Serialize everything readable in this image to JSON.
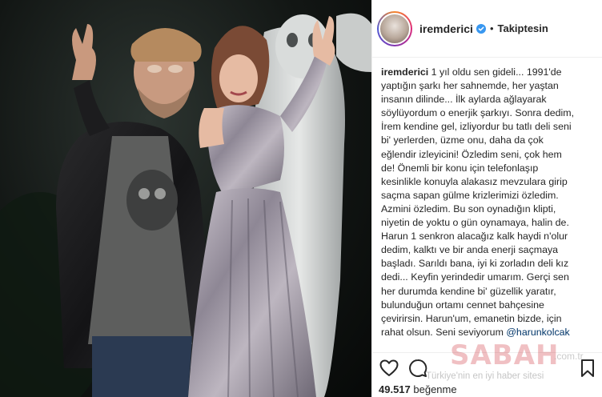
{
  "post": {
    "username": "iremderici",
    "separator": "•",
    "follow_status": "Takiptesin",
    "caption_user": "iremderici",
    "caption_lines": [
      " 1 yıl oldu sen gideli... 1991'de",
      "yaptığın şarkı her sahnemde, her yaştan",
      "insanın dilinde... İlk aylarda ağlayarak",
      "söylüyordum o enerjik şarkıyı. Sonra dedim,",
      "İrem kendine gel, izliyordur bu tatlı deli seni",
      "bi' yerlerden, üzme onu, daha da çok",
      "eğlendir izleyicini! Özledim seni, çok hem",
      "de! Önemli bir konu için telefonlaşıp",
      "kesinlikle konuyla alakasız mevzulara girip",
      "saçma sapan gülme krizlerimizi özledim.",
      "Azmini özledim. Bu son oynadığın klipti,",
      "niyetin de yoktu o gün oynamaya, halin de.",
      "Harun 1 senkron alacağız kalk haydi n'olur",
      "dedim, kalktı ve bir anda enerji saçmaya",
      "başladı. Sarıldı bana, iyi ki zorladın deli kız",
      "dedi... Keyfin yerindedir umarım. Gerçi sen",
      "her durumda kendine bi' güzellik yaratır,",
      "bulunduğun ortamı cennet bahçesine",
      "çevirirsin. Harun'um, emanetin bizde, için",
      "rahat olsun. Seni seviyorum "
    ],
    "mention": "@harunkolcak",
    "likes_count": "49.517",
    "likes_label": "beğenme"
  },
  "icons": {
    "verified": "verified-badge-icon",
    "like": "heart-icon",
    "comment": "comment-icon",
    "save": "bookmark-icon"
  },
  "watermark": {
    "brand": "SABAH",
    "tld": ".com.tr",
    "slogan": "Türkiye'nin en iyi haber sitesi"
  },
  "colors": {
    "verified_blue": "#3897f0",
    "mention": "#003569",
    "border": "#efefef"
  }
}
